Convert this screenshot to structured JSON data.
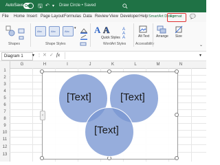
{
  "titlebar": {
    "autosave_label": "AutoSave",
    "autosave_state": "On",
    "doc_title": "Draw Circle • Saved"
  },
  "menu": {
    "tabs": [
      "File",
      "Home",
      "Insert",
      "Page Layout",
      "Formulas",
      "Data",
      "Review",
      "View",
      "Developer",
      "Help",
      "SmartArt Design",
      "Format"
    ],
    "selected": "Format"
  },
  "ribbon": {
    "groups": {
      "shapes": "Shapes",
      "shape_styles": "Shape Styles",
      "wordart_styles": "WordArt Styles",
      "accessibility": "Accessibility"
    },
    "style_sample": "Abc",
    "quick_styles_label": "Quick Styles",
    "alt_text_label": "Alt Text",
    "arrange_label": "Arrange",
    "size_label": "Size"
  },
  "formula_bar": {
    "name_box": "Diagram 1"
  },
  "grid": {
    "columns": [
      "G",
      "H",
      "I",
      "J",
      "K",
      "L",
      "M",
      "N"
    ],
    "rows": [
      "1",
      "2",
      "3",
      "4",
      "5",
      "6",
      "7",
      "8",
      "9",
      "10",
      "11",
      "12",
      "13"
    ]
  },
  "smartart": {
    "circles": [
      {
        "text": "[Text]"
      },
      {
        "text": "[Text]"
      },
      {
        "text": "[Text]"
      }
    ],
    "fill_color": "#7d9bd5"
  },
  "colors": {
    "title_bar": "#1f7245",
    "highlight_box": "#e03030"
  }
}
